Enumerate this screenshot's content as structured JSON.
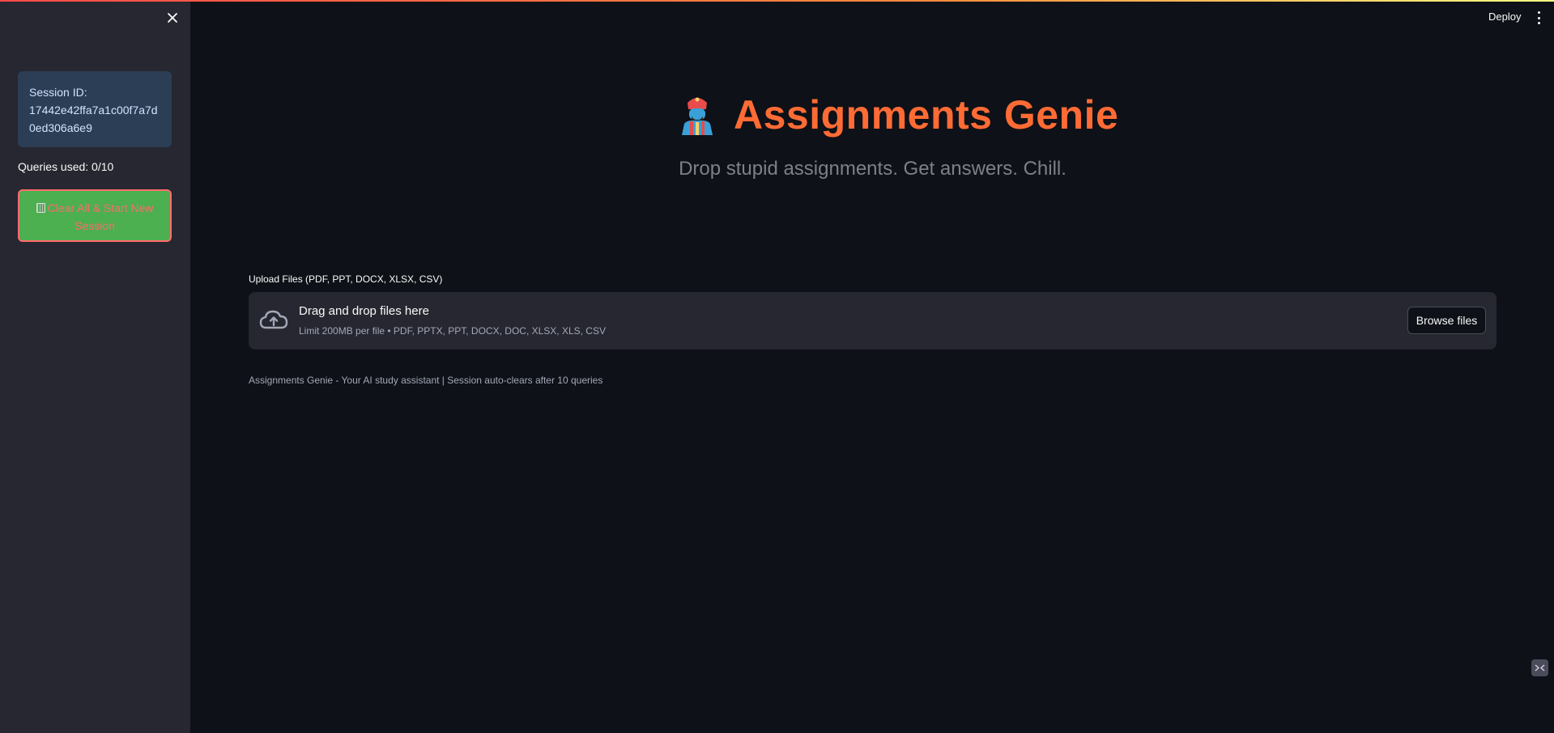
{
  "sidebar": {
    "session_label": "Session ID:",
    "session_id": "17442e42ffa7a1c00f7a7d0ed306a6e9",
    "queries_used": "Queries used: 0/10",
    "clear_button": "Clear All & Start New Session"
  },
  "header": {
    "deploy_label": "Deploy"
  },
  "main": {
    "title": "Assignments Genie",
    "subtitle": "Drop stupid assignments. Get answers. Chill.",
    "upload": {
      "label": "Upload Files (PDF, PPT, DOCX, XLSX, CSV)",
      "drop_text": "Drag and drop files here",
      "limit_text": "Limit 200MB per file • PDF, PPTX, PPT, DOCX, DOC, XLSX, XLS, CSV",
      "browse_button": "Browse files"
    },
    "footer": "Assignments Genie - Your AI study assistant | Session auto-clears after 10 queries"
  },
  "icons": {
    "close": "close-icon",
    "trash": "wastebasket-icon",
    "genie": "genie-icon",
    "upload": "cloud-upload-icon",
    "menu": "kebab-menu-icon"
  },
  "colors": {
    "background": "#0e1117",
    "sidebar": "#262730",
    "accent_title": "#ff6b35",
    "clear_button_bg": "#4caf50",
    "clear_button_text": "#ff6b6b",
    "session_box": "#2c3e55"
  }
}
